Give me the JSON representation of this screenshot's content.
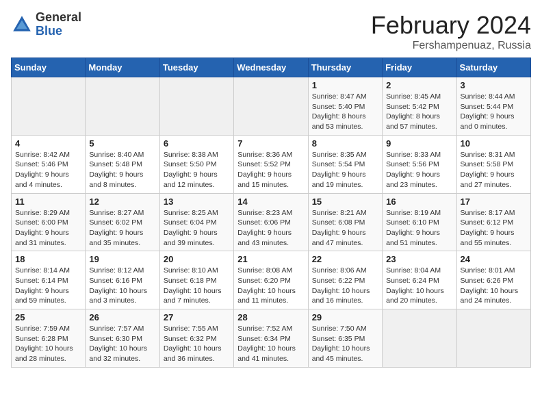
{
  "logo": {
    "general": "General",
    "blue": "Blue"
  },
  "title": {
    "month": "February 2024",
    "location": "Fershampenuaz, Russia"
  },
  "weekdays": [
    "Sunday",
    "Monday",
    "Tuesday",
    "Wednesday",
    "Thursday",
    "Friday",
    "Saturday"
  ],
  "weeks": [
    [
      {
        "day": "",
        "info": ""
      },
      {
        "day": "",
        "info": ""
      },
      {
        "day": "",
        "info": ""
      },
      {
        "day": "",
        "info": ""
      },
      {
        "day": "1",
        "info": "Sunrise: 8:47 AM\nSunset: 5:40 PM\nDaylight: 8 hours and 53 minutes."
      },
      {
        "day": "2",
        "info": "Sunrise: 8:45 AM\nSunset: 5:42 PM\nDaylight: 8 hours and 57 minutes."
      },
      {
        "day": "3",
        "info": "Sunrise: 8:44 AM\nSunset: 5:44 PM\nDaylight: 9 hours and 0 minutes."
      }
    ],
    [
      {
        "day": "4",
        "info": "Sunrise: 8:42 AM\nSunset: 5:46 PM\nDaylight: 9 hours and 4 minutes."
      },
      {
        "day": "5",
        "info": "Sunrise: 8:40 AM\nSunset: 5:48 PM\nDaylight: 9 hours and 8 minutes."
      },
      {
        "day": "6",
        "info": "Sunrise: 8:38 AM\nSunset: 5:50 PM\nDaylight: 9 hours and 12 minutes."
      },
      {
        "day": "7",
        "info": "Sunrise: 8:36 AM\nSunset: 5:52 PM\nDaylight: 9 hours and 15 minutes."
      },
      {
        "day": "8",
        "info": "Sunrise: 8:35 AM\nSunset: 5:54 PM\nDaylight: 9 hours and 19 minutes."
      },
      {
        "day": "9",
        "info": "Sunrise: 8:33 AM\nSunset: 5:56 PM\nDaylight: 9 hours and 23 minutes."
      },
      {
        "day": "10",
        "info": "Sunrise: 8:31 AM\nSunset: 5:58 PM\nDaylight: 9 hours and 27 minutes."
      }
    ],
    [
      {
        "day": "11",
        "info": "Sunrise: 8:29 AM\nSunset: 6:00 PM\nDaylight: 9 hours and 31 minutes."
      },
      {
        "day": "12",
        "info": "Sunrise: 8:27 AM\nSunset: 6:02 PM\nDaylight: 9 hours and 35 minutes."
      },
      {
        "day": "13",
        "info": "Sunrise: 8:25 AM\nSunset: 6:04 PM\nDaylight: 9 hours and 39 minutes."
      },
      {
        "day": "14",
        "info": "Sunrise: 8:23 AM\nSunset: 6:06 PM\nDaylight: 9 hours and 43 minutes."
      },
      {
        "day": "15",
        "info": "Sunrise: 8:21 AM\nSunset: 6:08 PM\nDaylight: 9 hours and 47 minutes."
      },
      {
        "day": "16",
        "info": "Sunrise: 8:19 AM\nSunset: 6:10 PM\nDaylight: 9 hours and 51 minutes."
      },
      {
        "day": "17",
        "info": "Sunrise: 8:17 AM\nSunset: 6:12 PM\nDaylight: 9 hours and 55 minutes."
      }
    ],
    [
      {
        "day": "18",
        "info": "Sunrise: 8:14 AM\nSunset: 6:14 PM\nDaylight: 9 hours and 59 minutes."
      },
      {
        "day": "19",
        "info": "Sunrise: 8:12 AM\nSunset: 6:16 PM\nDaylight: 10 hours and 3 minutes."
      },
      {
        "day": "20",
        "info": "Sunrise: 8:10 AM\nSunset: 6:18 PM\nDaylight: 10 hours and 7 minutes."
      },
      {
        "day": "21",
        "info": "Sunrise: 8:08 AM\nSunset: 6:20 PM\nDaylight: 10 hours and 11 minutes."
      },
      {
        "day": "22",
        "info": "Sunrise: 8:06 AM\nSunset: 6:22 PM\nDaylight: 10 hours and 16 minutes."
      },
      {
        "day": "23",
        "info": "Sunrise: 8:04 AM\nSunset: 6:24 PM\nDaylight: 10 hours and 20 minutes."
      },
      {
        "day": "24",
        "info": "Sunrise: 8:01 AM\nSunset: 6:26 PM\nDaylight: 10 hours and 24 minutes."
      }
    ],
    [
      {
        "day": "25",
        "info": "Sunrise: 7:59 AM\nSunset: 6:28 PM\nDaylight: 10 hours and 28 minutes."
      },
      {
        "day": "26",
        "info": "Sunrise: 7:57 AM\nSunset: 6:30 PM\nDaylight: 10 hours and 32 minutes."
      },
      {
        "day": "27",
        "info": "Sunrise: 7:55 AM\nSunset: 6:32 PM\nDaylight: 10 hours and 36 minutes."
      },
      {
        "day": "28",
        "info": "Sunrise: 7:52 AM\nSunset: 6:34 PM\nDaylight: 10 hours and 41 minutes."
      },
      {
        "day": "29",
        "info": "Sunrise: 7:50 AM\nSunset: 6:35 PM\nDaylight: 10 hours and 45 minutes."
      },
      {
        "day": "",
        "info": ""
      },
      {
        "day": "",
        "info": ""
      }
    ]
  ]
}
